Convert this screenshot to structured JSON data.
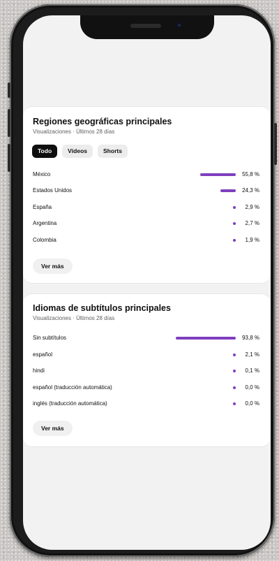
{
  "regions": {
    "title": "Regiones geográficas principales",
    "subtitle": "Visualizaciones · Últimos 28 días",
    "tabs": [
      {
        "label": "Todo",
        "active": true
      },
      {
        "label": "Vídeos",
        "active": false
      },
      {
        "label": "Shorts",
        "active": false
      }
    ],
    "rows": [
      {
        "label": "México",
        "value": "55,8 %",
        "pct": 55.8
      },
      {
        "label": "Estados Unidos",
        "value": "24,3 %",
        "pct": 24.3
      },
      {
        "label": "España",
        "value": "2,9 %",
        "pct": 2.9
      },
      {
        "label": "Argentina",
        "value": "2,7 %",
        "pct": 2.7
      },
      {
        "label": "Colombia",
        "value": "1,9 %",
        "pct": 1.9
      }
    ],
    "more_label": "Ver más"
  },
  "subtitles": {
    "title": "Idiomas de subtítulos principales",
    "subtitle": "Visualizaciones · Últimos 28 días",
    "rows": [
      {
        "label": "Sin subtítulos",
        "value": "93,8 %",
        "pct": 93.8
      },
      {
        "label": "español",
        "value": "2,1 %",
        "pct": 2.1
      },
      {
        "label": "hindi",
        "value": "0,1 %",
        "pct": 0.1
      },
      {
        "label": "español (traducción automática)",
        "value": "0,0 %",
        "pct": 0.0
      },
      {
        "label": "inglés (traducción automática)",
        "value": "0,0 %",
        "pct": 0.0
      }
    ],
    "more_label": "Ver más"
  },
  "colors": {
    "bar": "#7f3fbf",
    "active_chip": "#0f0f0f"
  }
}
